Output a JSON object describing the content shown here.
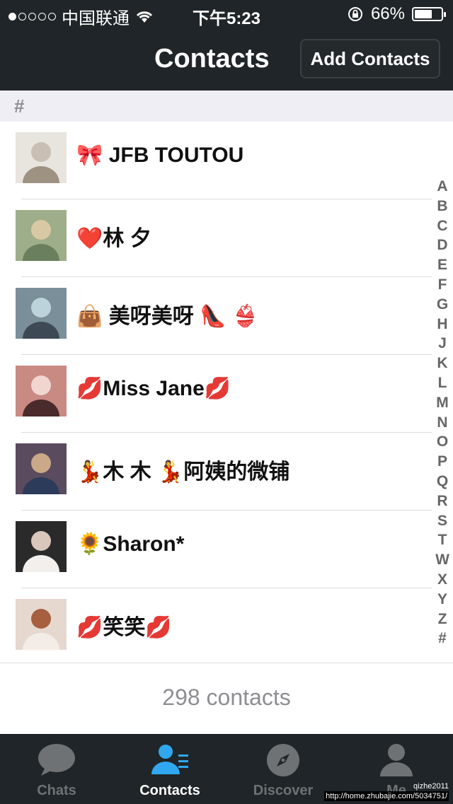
{
  "status_bar": {
    "carrier": "中国联通",
    "time": "下午5:23",
    "battery": "66%",
    "battery_level": 0.66
  },
  "nav": {
    "title": "Contacts",
    "add_button": "Add Contacts"
  },
  "section": {
    "header": "#"
  },
  "contacts": [
    {
      "name": "🎀 JFB TOUTOU",
      "avatar_colors": [
        "#e8e4de",
        "#c9bfb2",
        "#9e9283"
      ]
    },
    {
      "name": "❤️林 夕",
      "avatar_colors": [
        "#9fae8a",
        "#d8c9a4",
        "#6a7f5e"
      ]
    },
    {
      "name": "👜 美呀美呀 👠 👙",
      "avatar_colors": [
        "#7a8f9a",
        "#bcd3dc",
        "#3d4a55"
      ]
    },
    {
      "name": "💋Miss Jane💋",
      "avatar_colors": [
        "#c98a83",
        "#f0d6cf",
        "#4a2a2a"
      ]
    },
    {
      "name": "💃木 木 💃阿姨的微铺",
      "avatar_colors": [
        "#5b4b5e",
        "#c9a987",
        "#2c3b5a"
      ]
    },
    {
      "name": "🌻Sharon*",
      "avatar_colors": [
        "#2a2a2a",
        "#d9c7bb",
        "#f2efec"
      ]
    },
    {
      "name": "💋笑笑💋",
      "avatar_colors": [
        "#e6d8cf",
        "#a65f3f",
        "#f4ece6"
      ]
    }
  ],
  "footer": {
    "count": "298 contacts"
  },
  "index_letters": [
    "A",
    "B",
    "C",
    "D",
    "E",
    "F",
    "G",
    "H",
    "J",
    "K",
    "L",
    "M",
    "N",
    "O",
    "P",
    "Q",
    "R",
    "S",
    "T",
    "W",
    "X",
    "Y",
    "Z",
    "#"
  ],
  "tabs": [
    {
      "label": "Chats",
      "icon": "chat-bubble-icon",
      "active": false
    },
    {
      "label": "Contacts",
      "icon": "contacts-icon",
      "active": true
    },
    {
      "label": "Discover",
      "icon": "compass-icon",
      "active": false
    },
    {
      "label": "Me",
      "icon": "person-icon",
      "active": false
    }
  ],
  "watermark": {
    "user": "qizhe2011",
    "url": "http://home.zhubajie.com/5034751/"
  },
  "colors": {
    "bar": "#1f2528",
    "accent": "#2fa8f0",
    "inactive": "#6e7275"
  }
}
